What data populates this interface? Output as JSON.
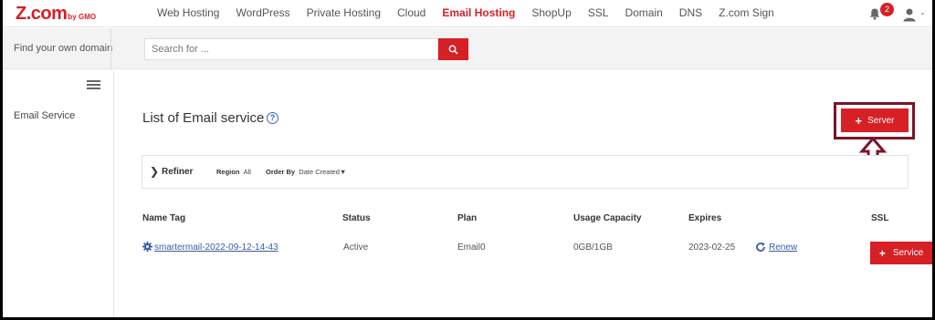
{
  "header": {
    "logo": "Z.com",
    "logo_suffix": "by GMO",
    "nav": [
      "Web Hosting",
      "WordPress",
      "Private Hosting",
      "Cloud",
      "Email Hosting",
      "ShopUp",
      "SSL",
      "Domain",
      "DNS",
      "Z.com Sign"
    ],
    "active_nav": "Email Hosting",
    "notification_count": "2",
    "icons": [
      "bell-icon",
      "user-icon",
      "chevron-down-icon"
    ]
  },
  "search": {
    "label": "Find your own domain",
    "placeholder": "Search for ..."
  },
  "sidebar": {
    "items": [
      {
        "label": "Email Service"
      }
    ]
  },
  "main": {
    "title": "List of Email service",
    "add_server_label": "Server",
    "refiner": {
      "label": "Refiner",
      "region_label": "Region",
      "region_value": "All",
      "order_label": "Order By",
      "order_value": "Date Created▼"
    },
    "table": {
      "columns": [
        "Name Tag",
        "Status",
        "Plan",
        "Usage Capacity",
        "Expires",
        "SSL"
      ],
      "rows": [
        {
          "name_tag": "smartermail-2022-09-12-14-43",
          "status": "Active",
          "plan": "Email0",
          "usage": "0GB/1GB",
          "expires": "2023-02-25",
          "renew": "Renew",
          "ssl_button": "Service"
        }
      ]
    }
  },
  "colors": {
    "brand_red": "#d71f26",
    "highlight_border": "#7a1427",
    "link_blue": "#3a5ba8"
  }
}
